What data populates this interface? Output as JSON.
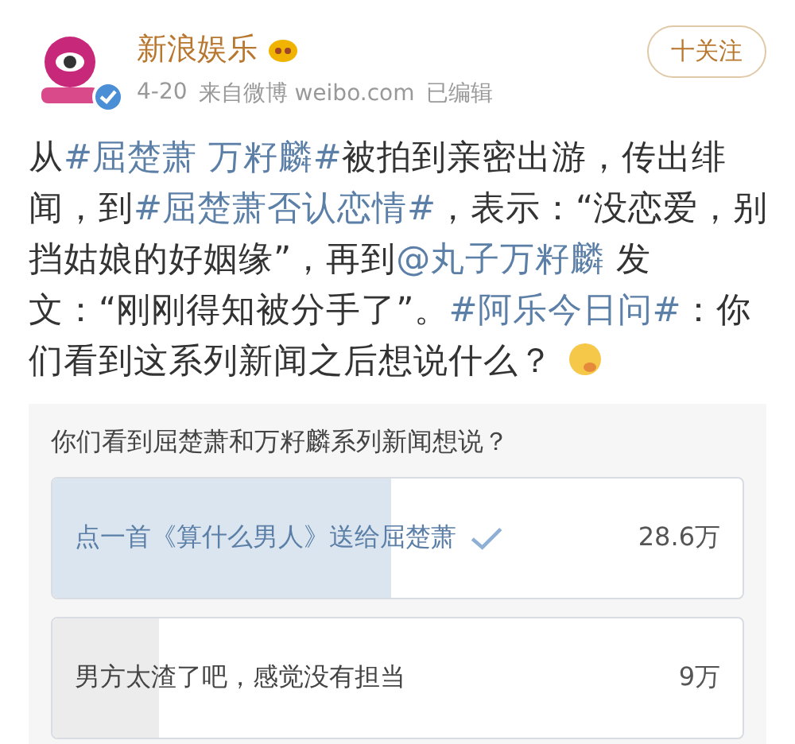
{
  "post": {
    "author": "新浪娱乐",
    "verified": true,
    "follow_button": "十关注",
    "date": "4-20",
    "source": "来自微博 weibo.com",
    "edited": "已编辑",
    "text": [
      {
        "kind": "plain",
        "text": "从"
      },
      {
        "kind": "link",
        "text": "#屈楚萧 万籽麟#"
      },
      {
        "kind": "plain",
        "text": "被拍到亲密出游，传出绯闻，到"
      },
      {
        "kind": "link",
        "text": "#屈楚萧否认恋情#"
      },
      {
        "kind": "plain",
        "text": "，表示：“没恋爱，别挡姑娘的好姻缘”，再到"
      },
      {
        "kind": "link",
        "text": "@丸子万籽麟"
      },
      {
        "kind": "plain",
        "text": " 发文：“刚刚得知被分手了”。"
      },
      {
        "kind": "link",
        "text": "#阿乐今日问#"
      },
      {
        "kind": "plain",
        "text": "：你们看到这系列新闻之后想说什么？"
      }
    ]
  },
  "poll": {
    "question": "你们看到屈楚萧和万籽麟系列新闻想说？",
    "options": [
      {
        "label": "点一首《算什么男人》送给屈楚萧",
        "count": "28.6万",
        "level": 0.49,
        "selected": true
      },
      {
        "label": "男方太渣了吧，感觉没有担当",
        "count": "9万",
        "level": 0.155,
        "selected": false
      }
    ]
  }
}
